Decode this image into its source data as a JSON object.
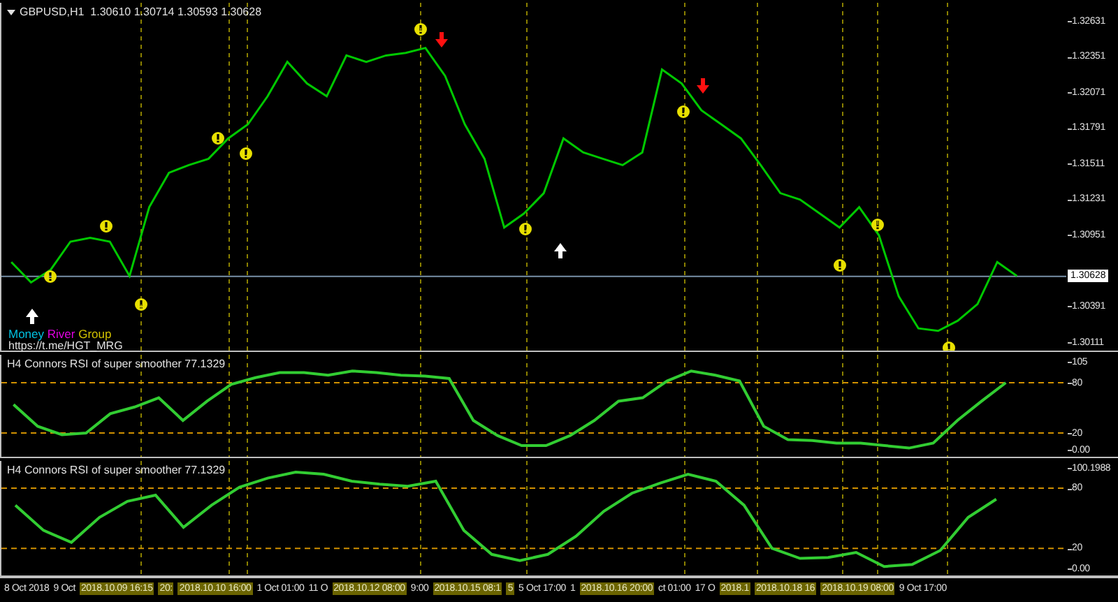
{
  "price_panel": {
    "title": "GBPUSD,H1  1.30610 1.30714 1.30593 1.30628",
    "brand": {
      "parts": [
        {
          "text": "Money",
          "color": "#00c0e0"
        },
        {
          "text": "River",
          "color": "#e000e0"
        },
        {
          "text": "Group",
          "color": "#d0c000"
        }
      ],
      "link": "https://t.me/HGT_MRG"
    },
    "markers": [
      {
        "kind": "alert"
      },
      {
        "kind": "alert"
      },
      {
        "kind": "alert"
      },
      {
        "kind": "alert"
      },
      {
        "kind": "alert"
      },
      {
        "kind": "alert"
      },
      {
        "kind": "alert"
      },
      {
        "kind": "alert"
      },
      {
        "kind": "alert"
      },
      {
        "kind": "alert"
      },
      {
        "kind": "alert"
      },
      {
        "kind": "sell"
      },
      {
        "kind": "sell"
      },
      {
        "kind": "buy"
      },
      {
        "kind": "buy"
      }
    ],
    "chart_data": {
      "type": "line",
      "ylim": [
        1.30111,
        1.32631
      ],
      "categories": [
        null,
        null,
        null,
        null,
        null,
        null,
        null,
        null,
        null,
        null,
        null,
        null,
        null,
        null,
        null,
        null,
        null,
        null,
        null,
        null,
        null,
        null,
        null,
        null,
        null,
        null,
        null,
        null,
        null,
        null,
        null,
        null,
        null,
        null,
        null,
        null,
        null,
        null,
        null,
        null,
        null,
        null,
        null,
        null,
        null,
        null,
        null,
        null,
        null,
        null,
        null,
        null,
        null,
        null
      ],
      "series": [
        {
          "color": "#00c800",
          "values": [
            1.3074,
            1.3058,
            1.3068,
            1.309,
            1.3093,
            1.309,
            1.3063,
            1.3117,
            1.3144,
            1.315,
            1.3155,
            1.3171,
            1.3182,
            1.3204,
            1.3231,
            1.3214,
            1.3204,
            1.3236,
            1.3231,
            1.3236,
            1.3238,
            1.3242,
            1.322,
            1.3182,
            1.3155,
            1.3101,
            1.3112,
            1.3128,
            1.3171,
            1.316,
            1.3155,
            1.315,
            1.316,
            1.3225,
            1.3214,
            1.3193,
            1.3182,
            1.3171,
            1.315,
            1.3128,
            1.3123,
            1.3112,
            1.3101,
            1.3117,
            1.3095,
            1.3047,
            1.3022,
            1.302,
            1.3028,
            1.3041,
            1.3074,
            1.3063,
            null,
            null
          ]
        }
      ],
      "yticks": [
        {
          "value": 1.32631,
          "label": "1.32631"
        },
        {
          "value": 1.32351,
          "label": "1.32351"
        },
        {
          "value": 1.32071,
          "label": "1.32071"
        },
        {
          "value": 1.31791,
          "label": "1.31791"
        },
        {
          "value": 1.31511,
          "label": "1.31511"
        },
        {
          "value": 1.31231,
          "label": "1.31231"
        },
        {
          "value": 1.30951,
          "label": "1.30951"
        },
        {
          "value": 1.30391,
          "label": "1.30391"
        },
        {
          "value": 1.30111,
          "label": "1.30111"
        }
      ],
      "ref_lines": [
        {
          "axis": "y",
          "value": 1.30628,
          "label": "1.30628"
        }
      ],
      "grid": true
    }
  },
  "indicator_panels": [
    {
      "title": "H4 Connors RSI of super smoother 77.1329",
      "chart_data": {
        "type": "line",
        "ylim": [
          0,
          105
        ],
        "categories": [
          null,
          null,
          null,
          null,
          null,
          null,
          null,
          null,
          null,
          null,
          null,
          null,
          null,
          null,
          null,
          null,
          null,
          null,
          null,
          null,
          null,
          null,
          null,
          null,
          null,
          null,
          null,
          null,
          null,
          null,
          null,
          null,
          null,
          null,
          null,
          null,
          null,
          null,
          null,
          null,
          null,
          null,
          null,
          null
        ],
        "series": [
          {
            "color": "#32cd32",
            "values": [
              54,
              28,
              18,
              20,
              43,
              51,
              62,
              35,
              58,
              78,
              86,
              92,
              92,
              89,
              94,
              92,
              89,
              88,
              85,
              35,
              17,
              5,
              5,
              17,
              35,
              58,
              62,
              82,
              94,
              89,
              82,
              28,
              12,
              11,
              8,
              8,
              5,
              2,
              8,
              35,
              58,
              80,
              null,
              null
            ]
          }
        ],
        "yticks": [
          {
            "value": 105,
            "label": "105"
          },
          {
            "value": 80,
            "label": "80"
          },
          {
            "value": 20,
            "label": "20"
          },
          {
            "value": 0,
            "label": "0.00"
          }
        ],
        "ref_lines": [
          {
            "axis": "y",
            "value": 80
          },
          {
            "axis": "y",
            "value": 20
          }
        ],
        "grid": true
      }
    },
    {
      "title": "H4 Connors RSI of super smoother 77.1329",
      "chart_data": {
        "type": "line",
        "ylim": [
          0,
          100.1988
        ],
        "categories": [
          null,
          null,
          null,
          null,
          null,
          null,
          null,
          null,
          null,
          null,
          null,
          null,
          null,
          null,
          null,
          null,
          null,
          null,
          null,
          null,
          null,
          null,
          null,
          null,
          null,
          null,
          null,
          null,
          null,
          null,
          null,
          null,
          null,
          null,
          null,
          null,
          null,
          null
        ],
        "series": [
          {
            "color": "#32cd32",
            "values": [
              63,
              38,
              26,
              51,
              67,
              73,
              41,
              63,
              81,
              90,
              96,
              94,
              87,
              84,
              82,
              87,
              38,
              14,
              8,
              14,
              32,
              57,
              75,
              85,
              94,
              87,
              63,
              20,
              10,
              11,
              16,
              2,
              4,
              18,
              51,
              69,
              null,
              null
            ]
          }
        ],
        "yticks": [
          {
            "value": 100.1988,
            "label": "100.1988"
          },
          {
            "value": 80,
            "label": "80"
          },
          {
            "value": 20,
            "label": "20"
          },
          {
            "value": 0,
            "label": "0.00"
          }
        ],
        "ref_lines": [
          {
            "axis": "y",
            "value": 80
          },
          {
            "axis": "y",
            "value": 20
          }
        ],
        "grid": true
      }
    }
  ],
  "time_axis": [
    {
      "text": "8 Oct 2018",
      "highlighted": false
    },
    {
      "text": "9 Oct",
      "highlighted": false
    },
    {
      "text": "2018.10.09 16:15",
      "highlighted": true
    },
    {
      "text": "20:",
      "highlighted": true
    },
    {
      "text": "2018.10.10 16:00",
      "highlighted": true
    },
    {
      "text": "1 Oct 01:00",
      "highlighted": false
    },
    {
      "text": "11 O",
      "highlighted": false
    },
    {
      "text": "2018.10.12 08:00",
      "highlighted": true
    },
    {
      "text": "9:00",
      "highlighted": false
    },
    {
      "text": "2018.10.15 08:1",
      "highlighted": true
    },
    {
      "text": "5",
      "highlighted": true
    },
    {
      "text": "5 Oct 17:00",
      "highlighted": false
    },
    {
      "text": "1",
      "highlighted": false
    },
    {
      "text": "2018.10.16 20:00",
      "highlighted": true
    },
    {
      "text": "ct 01:00",
      "highlighted": false
    },
    {
      "text": "17 O",
      "highlighted": false
    },
    {
      "text": "2018.1",
      "highlighted": true
    },
    {
      "text": "2018.10.18 16",
      "highlighted": true
    },
    {
      "text": "2018.10.19 08:00",
      "highlighted": true
    },
    {
      "text": "9 Oct 17:00",
      "highlighted": false
    }
  ]
}
